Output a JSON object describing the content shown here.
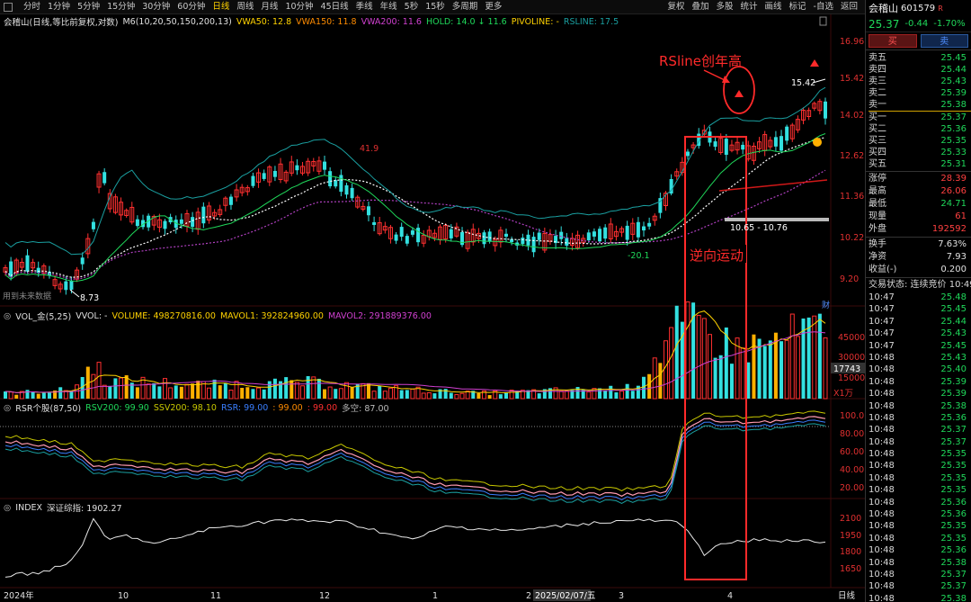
{
  "toolbar": {
    "periods": [
      "分时",
      "1分钟",
      "5分钟",
      "15分钟",
      "30分钟",
      "60分钟",
      "日线",
      "周线",
      "月线",
      "10分钟",
      "45日线",
      "季线",
      "年线",
      "5秒",
      "15秒",
      "多周期",
      "更多"
    ],
    "active_period": "日线",
    "tools": [
      "复权",
      "叠加",
      "多股",
      "统计",
      "画线",
      "标记",
      "-自选",
      "返回"
    ]
  },
  "main_legend": {
    "title": "会稽山(日线,等比前复权,对数)",
    "ma": "M6(10,20,50,150,200,13)",
    "vwa50": "VWA50: 12.8",
    "vwa150": "VWA150: 11.8",
    "vwa200": "VWA200: 11.6",
    "hold": "HOLD: 14.0 ↓ 11.6",
    "pivoline": "PIVOLINE: -",
    "rsline": "RSLINE: 17.5"
  },
  "vol_legend": {
    "name": "VOL_金(5,25)",
    "vvol": "VVOL: -",
    "volume": "VOLUME: 498270816.00",
    "mavol1": "MAVOL1: 392824960.00",
    "mavol2": "MAVOL2: 291889376.00"
  },
  "rsr_legend": {
    "name": "RSR个股(87,50)",
    "rsv200": "RSV200: 99.90",
    "ssv200": "SSV200: 98.10",
    "rsr": "RSR: 99.00",
    "v1": ": 99.00",
    "v2": ": 99.00",
    "duokong": "多空: 87.00"
  },
  "index_legend": {
    "name": "INDEX",
    "value": "深证综指: 1902.27"
  },
  "price_axis": [
    "16.96",
    "15.42",
    "14.02",
    "12.62",
    "11.36",
    "10.22",
    "9.20"
  ],
  "vol_axis": [
    "45000",
    "30000",
    "15000"
  ],
  "vol_axis_current": "17743",
  "vol_unit": "X1万",
  "rsr_axis": [
    "100.0",
    "80.00",
    "60.00",
    "40.00",
    "20.00"
  ],
  "index_axis": [
    "2100",
    "1950",
    "1800",
    "1650"
  ],
  "time_axis": [
    {
      "label": "2024年"
    },
    {
      "label": "10"
    },
    {
      "label": "11"
    },
    {
      "label": "12"
    },
    {
      "label": "1"
    },
    {
      "label": "2"
    },
    {
      "label": "2025/02/07/五"
    },
    {
      "label": "3"
    },
    {
      "label": "4"
    }
  ],
  "time_axis_mode": "日线",
  "annotations": {
    "rsline_high": "RSline创年高",
    "reverse_move": "逆向运动",
    "left_note": "用到未来数据",
    "low_label": "8.73",
    "high_label": "41.9",
    "dip_label": "-20.1",
    "range_label": "10.65 - 10.76",
    "peak_label": "15.42",
    "corner_mark": "财"
  },
  "colors": {
    "up": "#ff3030",
    "down": "#33e0e0",
    "vwa50": "#ffd200",
    "vwa150": "#ff8c00",
    "vwa200": "#d040d0",
    "hold": "#1fd85a",
    "pivoline": "#ffd200",
    "rsline": "#1a9fa0",
    "annot": "#ff2a2a"
  },
  "quote": {
    "name": "会稽山",
    "code": "601579",
    "flag": "R",
    "last": "25.37",
    "change": "-0.44",
    "pct": "-1.70%",
    "buy_label": "买",
    "sell_label": "卖",
    "asks": [
      {
        "label": "卖五",
        "price": "25.45"
      },
      {
        "label": "卖四",
        "price": "25.44"
      },
      {
        "label": "卖三",
        "price": "25.43"
      },
      {
        "label": "卖二",
        "price": "25.39"
      },
      {
        "label": "卖一",
        "price": "25.38"
      }
    ],
    "bids": [
      {
        "label": "买一",
        "price": "25.37"
      },
      {
        "label": "买二",
        "price": "25.36"
      },
      {
        "label": "买三",
        "price": "25.35"
      },
      {
        "label": "买四",
        "price": "25.33"
      },
      {
        "label": "买五",
        "price": "25.31"
      }
    ],
    "stats1": [
      {
        "label": "涨停",
        "value": "28.39",
        "tone": "red"
      },
      {
        "label": "最高",
        "value": "26.06",
        "tone": "red"
      },
      {
        "label": "最低",
        "value": "24.71",
        "tone": "grn"
      },
      {
        "label": "现量",
        "value": "61",
        "tone": "red"
      },
      {
        "label": "外盘",
        "value": "192592",
        "tone": "red"
      }
    ],
    "stats2": [
      {
        "label": "换手",
        "value": "7.63%",
        "tone": "wht"
      },
      {
        "label": "净资",
        "value": "7.93",
        "tone": "wht"
      },
      {
        "label": "收益(-)",
        "value": "0.200",
        "tone": "wht"
      }
    ],
    "trade_status": "交易状态: 连续竞价 10:49",
    "ticks": [
      {
        "t": "10:47",
        "p": "25.48"
      },
      {
        "t": "10:47",
        "p": "25.45"
      },
      {
        "t": "10:47",
        "p": "25.44"
      },
      {
        "t": "10:47",
        "p": "25.43"
      },
      {
        "t": "10:47",
        "p": "25.45"
      },
      {
        "t": "10:48",
        "p": "25.43"
      },
      {
        "t": "10:48",
        "p": "25.40"
      },
      {
        "t": "10:48",
        "p": "25.39"
      },
      {
        "t": "10:48",
        "p": "25.39"
      },
      {
        "t": "10:48",
        "p": "25.38"
      },
      {
        "t": "10:48",
        "p": "25.36"
      },
      {
        "t": "10:48",
        "p": "25.37"
      },
      {
        "t": "10:48",
        "p": "25.37"
      },
      {
        "t": "10:48",
        "p": "25.35"
      },
      {
        "t": "10:48",
        "p": "25.35"
      },
      {
        "t": "10:48",
        "p": "25.35"
      },
      {
        "t": "10:48",
        "p": "25.35"
      },
      {
        "t": "10:48",
        "p": "25.36"
      },
      {
        "t": "10:48",
        "p": "25.36"
      },
      {
        "t": "10:48",
        "p": "25.35"
      },
      {
        "t": "10:48",
        "p": "25.35"
      },
      {
        "t": "10:48",
        "p": "25.36"
      },
      {
        "t": "10:48",
        "p": "25.38"
      },
      {
        "t": "10:48",
        "p": "25.37"
      },
      {
        "t": "10:48",
        "p": "25.37"
      },
      {
        "t": "10:48",
        "p": "25.38"
      },
      {
        "t": "10:48",
        "p": "25.37"
      },
      {
        "t": "10:48",
        "p": "25.36"
      }
    ]
  }
}
